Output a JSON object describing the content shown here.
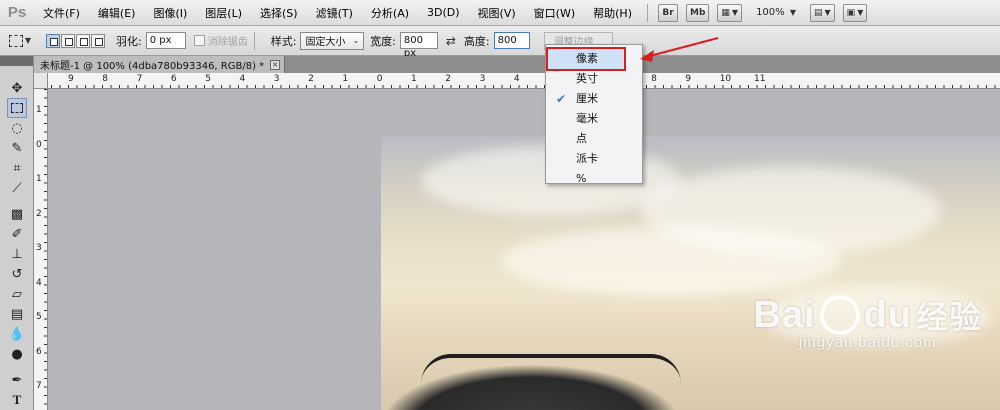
{
  "app": {
    "logo": "Ps"
  },
  "menu": [
    "文件(F)",
    "编辑(E)",
    "图像(I)",
    "图层(L)",
    "选择(S)",
    "滤镜(T)",
    "分析(A)",
    "3D(D)",
    "视图(V)",
    "窗口(W)",
    "帮助(H)"
  ],
  "toolbar": {
    "bridge": "Br",
    "mini_bridge": "Mb",
    "zoom": "100%"
  },
  "options": {
    "feather_label": "羽化:",
    "feather_value": "0 px",
    "antialias_label": "消除锯齿",
    "style_label": "样式:",
    "style_value": "固定大小",
    "width_label": "宽度:",
    "width_value": "800 px",
    "height_label": "高度:",
    "height_value": "800",
    "refine_edge": "调整边缘..."
  },
  "document": {
    "tab_title": "未标题-1 @ 100% (4dba780b93346, RGB/8) *"
  },
  "rulers": {
    "h_numbers": [
      "9",
      "8",
      "7",
      "6",
      "5",
      "4",
      "3",
      "2",
      "1",
      "0",
      "1",
      "2",
      "3",
      "4",
      "5",
      "6",
      "7",
      "8",
      "9",
      "10",
      "11"
    ],
    "v_numbers": [
      "1",
      "0",
      "1",
      "2",
      "3",
      "4",
      "5",
      "6",
      "7"
    ]
  },
  "unit_dropdown": {
    "items": [
      "像素",
      "英寸",
      "厘米",
      "毫米",
      "点",
      "派卡",
      "%"
    ],
    "highlighted": "像素",
    "checked": "厘米"
  },
  "watermark": {
    "brand": "Bai",
    "brand_tail": "du",
    "cn": "经验",
    "url": "jingyan.baidu.com"
  },
  "colors": {
    "annotation_red": "#d62020",
    "highlight_blue": "#cfe1f6",
    "check_blue": "#3c7fc4"
  }
}
